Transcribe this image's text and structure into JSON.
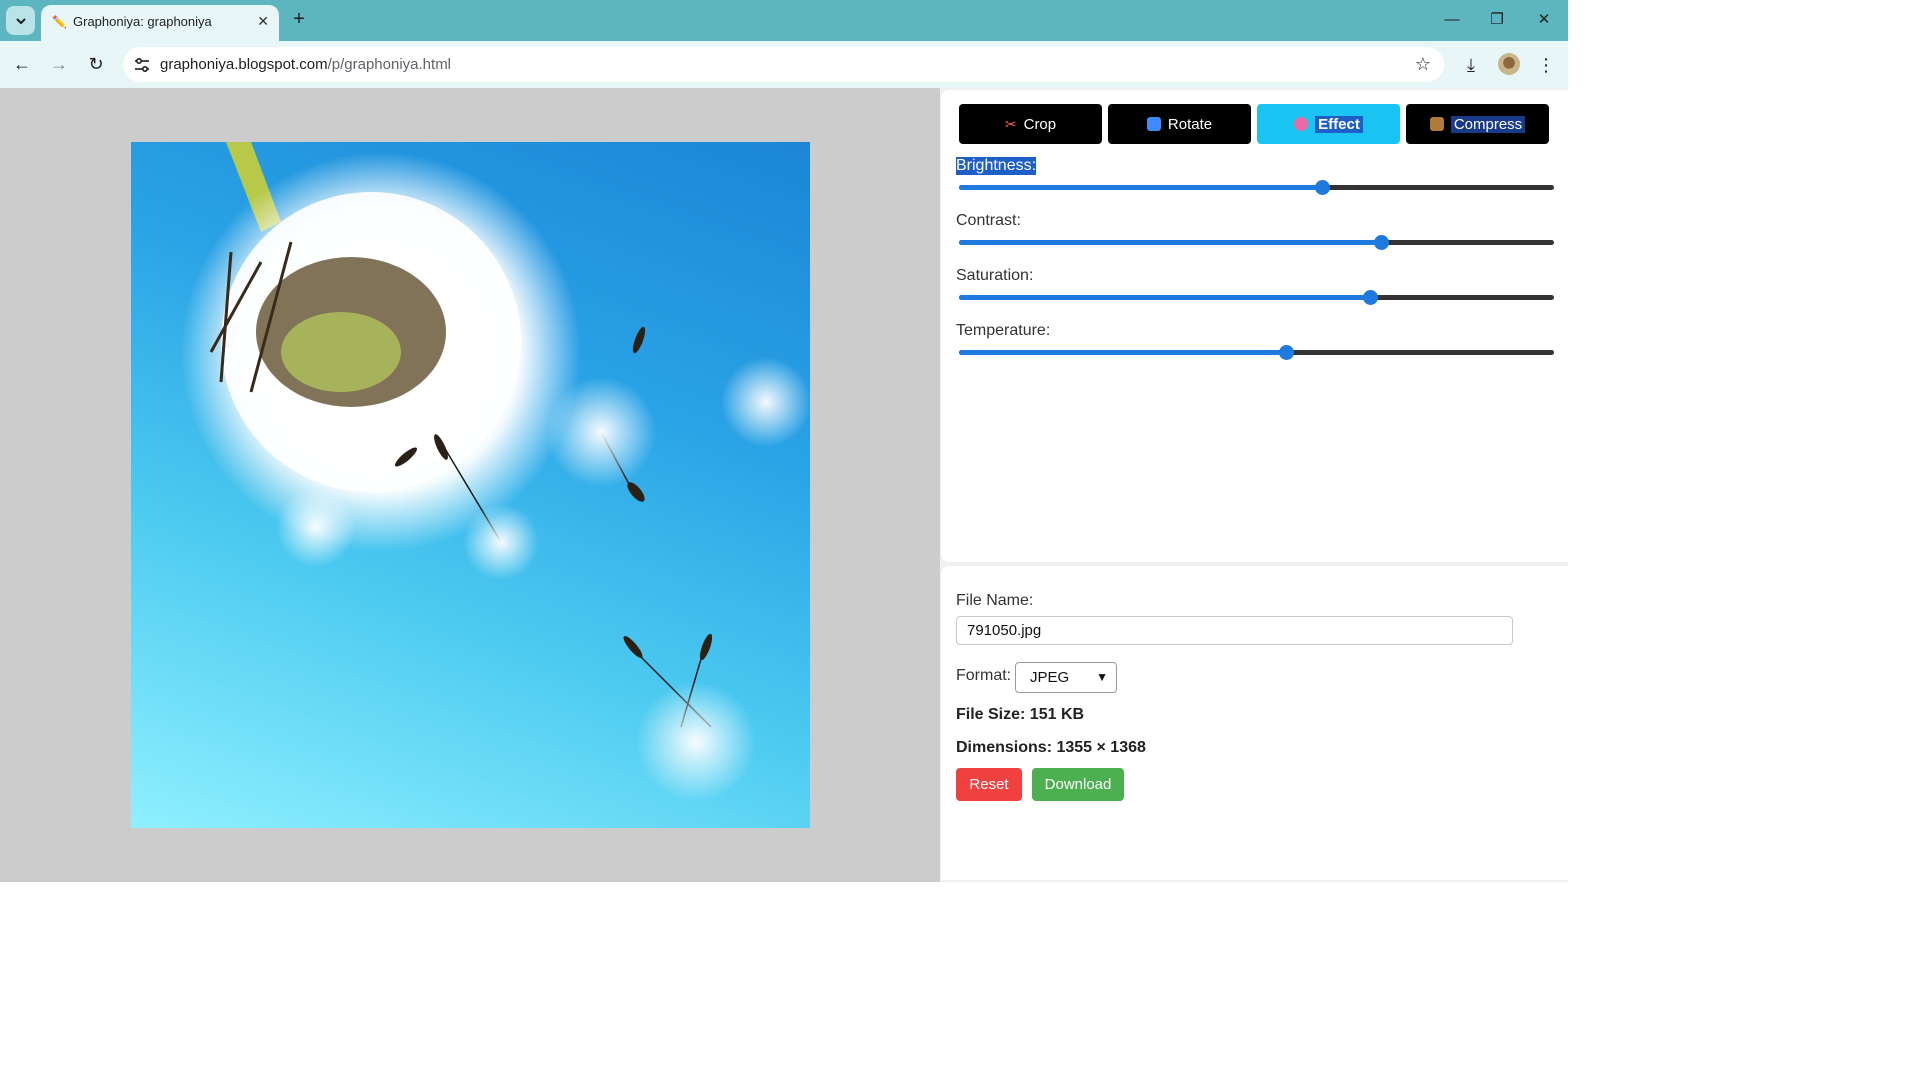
{
  "browser": {
    "tab_title": "Graphoniya: graphoniya",
    "url_domain": "graphoniya.blogspot.com",
    "url_path": "/p/graphoniya.html"
  },
  "editor": {
    "tools": [
      {
        "label": "Crop",
        "icon": "scissors-icon",
        "active": false
      },
      {
        "label": "Rotate",
        "icon": "rotate-icon",
        "active": false
      },
      {
        "label": "Effect",
        "icon": "palette-icon",
        "active": true
      },
      {
        "label": "Compress",
        "icon": "package-icon",
        "active": false
      }
    ],
    "adjustments": [
      {
        "label": "Brightness:",
        "value": 0.61
      },
      {
        "label": "Contrast:",
        "value": 0.71
      },
      {
        "label": "Saturation:",
        "value": 0.69
      },
      {
        "label": "Temperature:",
        "value": 0.55
      }
    ]
  },
  "file": {
    "name_label": "File Name:",
    "name_value": "791050.jpg",
    "format_label": "Format:",
    "format_value": "JPEG",
    "size_text": "File Size: 151 KB",
    "dimensions_text": "Dimensions: 1355 × 1368",
    "reset_label": "Reset",
    "download_label": "Download"
  },
  "colors": {
    "active_tool": "#19c4f2",
    "slider_accent": "#1f7ae0",
    "reset": "#f04040",
    "download": "#4caf50"
  }
}
